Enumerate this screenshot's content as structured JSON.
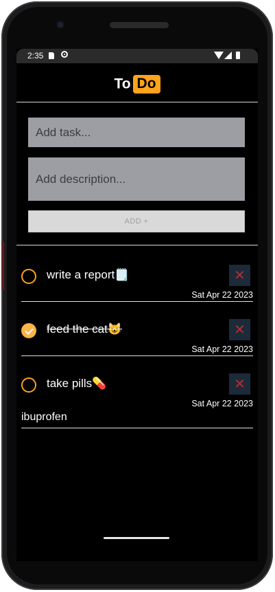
{
  "status": {
    "time": "2:35"
  },
  "header": {
    "title_part1": "To",
    "title_part2": "Do"
  },
  "form": {
    "task_placeholder": "Add task...",
    "description_placeholder": "Add description...",
    "add_label": "ADD +"
  },
  "tasks": [
    {
      "title": "write a report🗒️",
      "date": "Sat Apr 22 2023",
      "done": false,
      "description": ""
    },
    {
      "title": "feed the cat😺",
      "date": "Sat Apr 22 2023",
      "done": true,
      "description": ""
    },
    {
      "title": "take pills💊",
      "date": "Sat Apr 22 2023",
      "done": false,
      "description": "ibuprofen"
    }
  ],
  "delete_glyph": "✕",
  "colors": {
    "accent": "#ffa31a",
    "delete_bg": "#1d2a3a",
    "delete_x": "#b03030",
    "input_bg": "#9d9da4"
  }
}
